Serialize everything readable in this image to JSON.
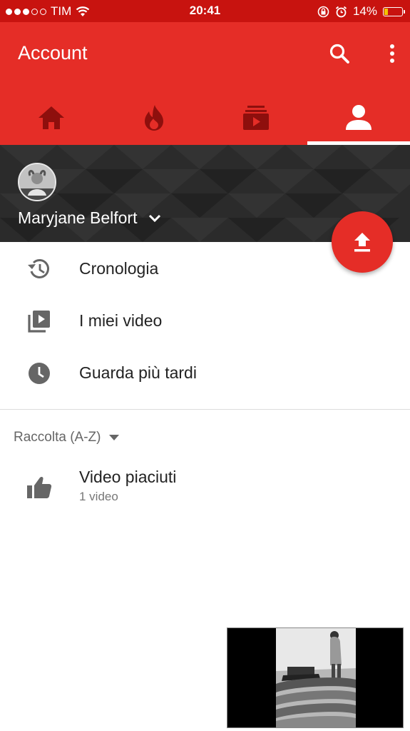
{
  "status_bar": {
    "carrier": "TIM",
    "time": "20:41",
    "battery": "14%",
    "signal_bars_filled": 3,
    "signal_bars_total": 5,
    "battery_level": 0.14
  },
  "app_bar": {
    "title": "Account",
    "color": "#e52d27",
    "tabs": [
      {
        "icon": "home-icon",
        "active": false
      },
      {
        "icon": "trending-icon",
        "active": false
      },
      {
        "icon": "subscriptions-icon",
        "active": false
      },
      {
        "icon": "account-icon",
        "active": true
      }
    ]
  },
  "profile": {
    "name": "Maryjane Belfort"
  },
  "menu": {
    "items": [
      {
        "label": "Cronologia",
        "icon": "history-icon"
      },
      {
        "label": "I miei video",
        "icon": "my-videos-icon"
      },
      {
        "label": "Guarda più tardi",
        "icon": "watch-later-icon"
      }
    ]
  },
  "library": {
    "header": "Raccolta (A-Z)",
    "playlists": [
      {
        "title": "Video piaciuti",
        "subtitle": "1 video",
        "icon": "thumbs-up-icon"
      }
    ]
  }
}
